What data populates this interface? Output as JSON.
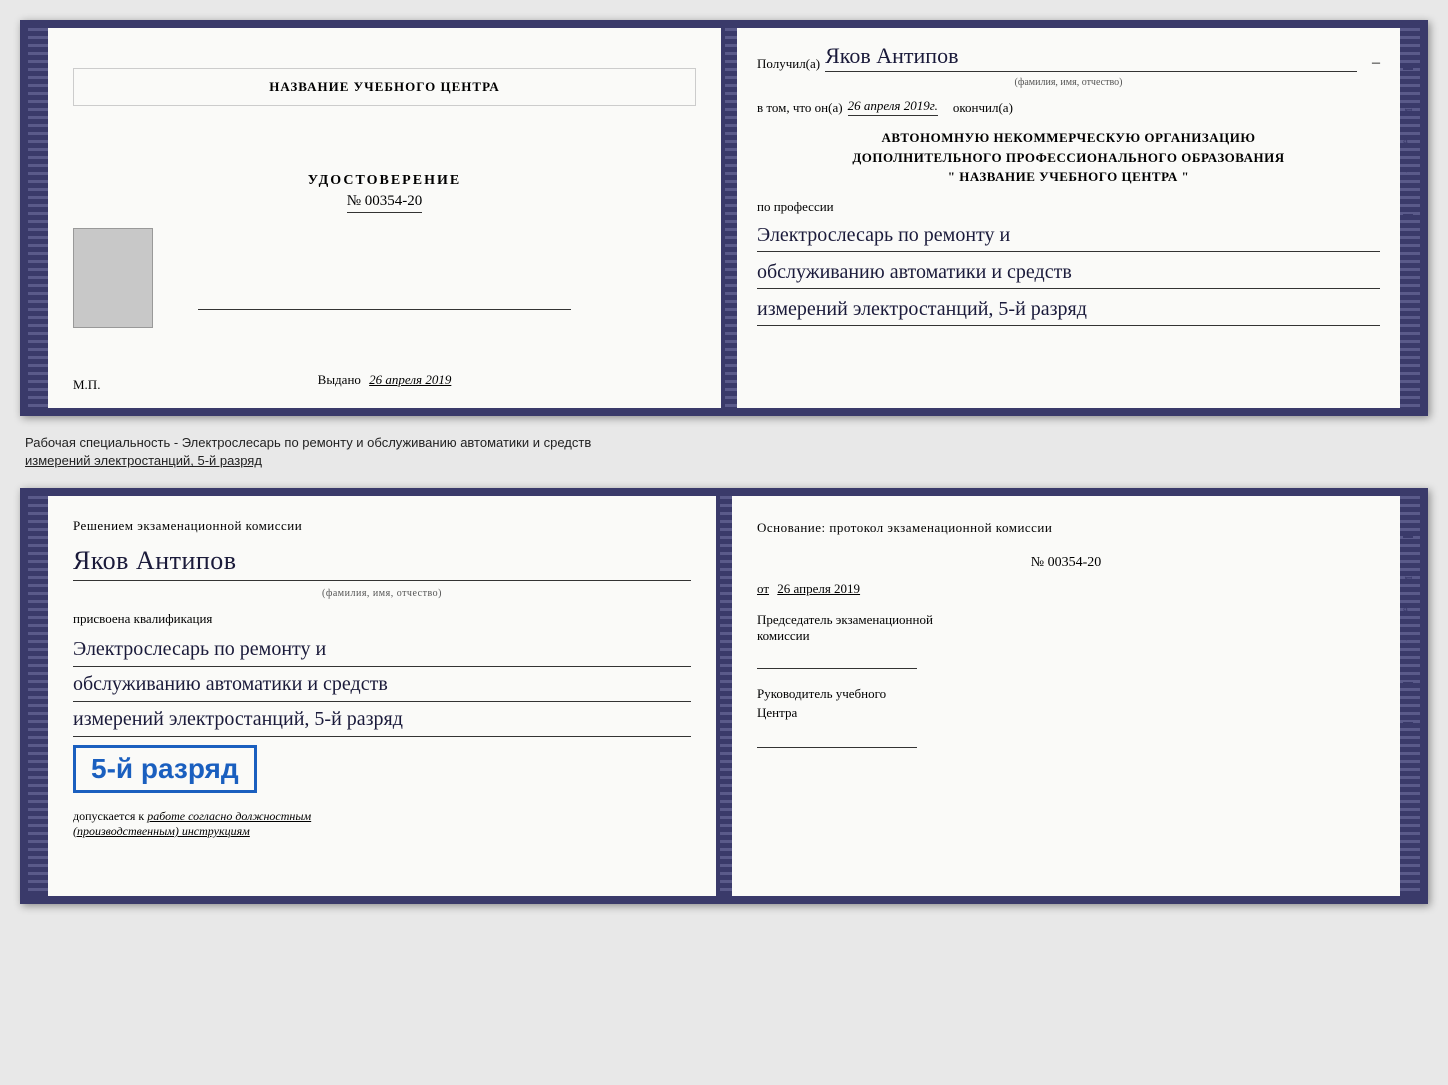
{
  "top_book": {
    "left": {
      "school_name": "НАЗВАНИЕ УЧЕБНОГО ЦЕНТРА",
      "udostoverenie_title": "УДОСТОВЕРЕНИЕ",
      "number": "№ 00354-20",
      "vydano_label": "Выдано",
      "vydano_date": "26 апреля 2019",
      "mp": "М.П."
    },
    "right": {
      "poluchil_label": "Получил(а)",
      "name_handwritten": "Яков Антипов",
      "fio_label": "(фамилия, имя, отчество)",
      "vtom_label": "в том, что он(а)",
      "date_handwritten": "26 апреля 2019г.",
      "okonchil_label": "окончил(а)",
      "org_line1": "АВТОНОМНУЮ НЕКОММЕРЧЕСКУЮ ОРГАНИЗАЦИЮ",
      "org_line2": "ДОПОЛНИТЕЛЬНОГО ПРОФЕССИОНАЛЬНОГО ОБРАЗОВАНИЯ",
      "org_line3": "\"  НАЗВАНИЕ УЧЕБНОГО ЦЕНТРА  \"",
      "profession_label": "по профессии",
      "profession_line1": "Электрослесарь по ремонту и",
      "profession_line2": "обслуживанию автоматики и средств",
      "profession_line3": "измерений электростанций, 5-й разряд"
    }
  },
  "between_text": {
    "line1": "Рабочая специальность - Электрослесарь по ремонту и обслуживанию автоматики и средств",
    "line2": "измерений электростанций, 5-й разряд"
  },
  "bottom_book": {
    "left": {
      "resheniem_label": "Решением  экзаменационной  комиссии",
      "name_handwritten": "Яков Антипов",
      "fio_label": "(фамилия, имя, отчество)",
      "prisvoena_label": "присвоена квалификация",
      "qual_line1": "Электрослесарь по ремонту и",
      "qual_line2": "обслуживанию автоматики и средств",
      "qual_line3": "измерений электростанций, 5-й разряд",
      "razryad_text": "5-й разряд",
      "dopusk_label": "допускается к",
      "dopusk_text": "работе согласно должностным",
      "dopusk_text2": "(производственным) инструкциям"
    },
    "right": {
      "osnovanie_label": "Основание: протокол  экзаменационной  комиссии",
      "number_label": "№ 00354-20",
      "ot_label": "от",
      "ot_date": "26 апреля 2019",
      "predsedatel_label": "Председатель экзаменационной",
      "predsedatel_label2": "комиссии",
      "rukovoditel_label": "Руководитель учебного",
      "rukovoditel_label2": "Центра"
    }
  }
}
